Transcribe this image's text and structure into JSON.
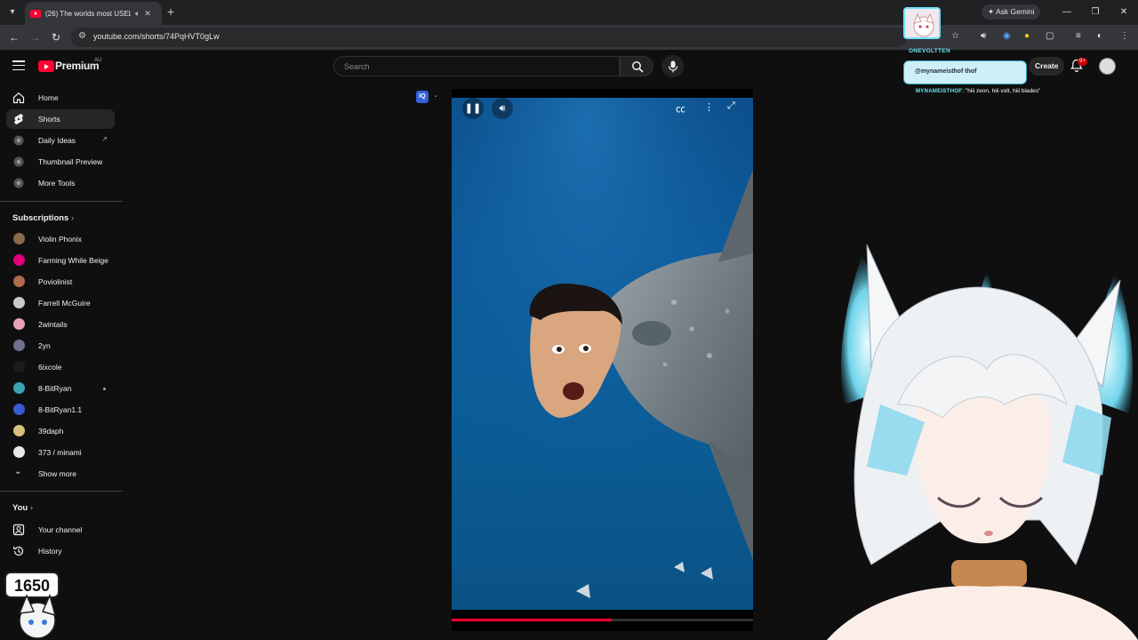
{
  "browser": {
    "tab_title": "(26) The worlds most USELE",
    "url": "youtube.com/shorts/74PqHVT0gLw",
    "ask_gemini": "Ask Gemini"
  },
  "header": {
    "brand": "Premium",
    "region": "AU",
    "search_placeholder": "Search",
    "create_label": "Create",
    "notification_count": "9+"
  },
  "sidebar": {
    "main_items": [
      {
        "label": "Home",
        "icon": "home-icon"
      },
      {
        "label": "Shorts",
        "icon": "shorts-icon"
      },
      {
        "label": "Daily Ideas",
        "icon": "extension-icon"
      },
      {
        "label": "Thumbnail Preview",
        "icon": "extension-icon"
      },
      {
        "label": "More Tools",
        "icon": "extension-icon"
      }
    ],
    "subscriptions_header": "Subscriptions",
    "subscriptions": [
      {
        "label": "Violin Phonix",
        "color": "#8a6a4e"
      },
      {
        "label": "Farming While Beige",
        "color": "#e0007a"
      },
      {
        "label": "Poviolinist",
        "color": "#b06a50"
      },
      {
        "label": "Farrell McGuire",
        "color": "#c9c9c9"
      },
      {
        "label": "2wintails",
        "color": "#e6a0b8"
      },
      {
        "label": "2yn",
        "color": "#707090"
      },
      {
        "label": "6ixcole",
        "color": "#1c1c1c"
      },
      {
        "label": "8-BitRyan",
        "color": "#3aa2b0"
      },
      {
        "label": "8-BitRyan1.1",
        "color": "#3a5ad0"
      },
      {
        "label": "39daph",
        "color": "#d8c07a"
      },
      {
        "label": "373 / minami",
        "color": "#e8e8e8"
      }
    ],
    "show_more": "Show more",
    "you_header": "You",
    "you_items": [
      {
        "label": "Your channel",
        "icon": "channel-icon"
      },
      {
        "label": "History",
        "icon": "history-icon"
      }
    ]
  },
  "player": {
    "progress_fraction": 0.53
  },
  "overlay": {
    "chat_user_1": "ONEVOLTTEN",
    "chat_message_user": "@mynameisthof",
    "chat_message_suffix": "thof",
    "chat_user_2": "MYNAMEISTHOF",
    "chat_text": "\"hiii zeon, hiii volt, hiii blades\"",
    "badge_number": "1650"
  }
}
